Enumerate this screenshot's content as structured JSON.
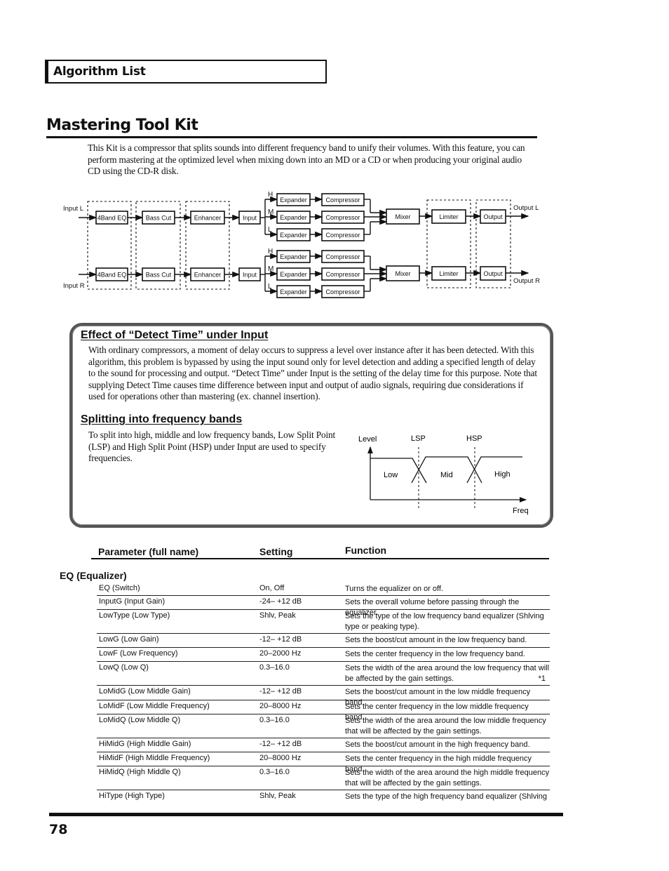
{
  "header": {
    "section_label": "Algorithm List"
  },
  "page_title": "Mastering Tool Kit",
  "intro": "This Kit is a compressor that splits sounds into different frequency band to unify their volumes. With this feature, you can perform mastering at the optimized level when mixing down into an MD or a CD or when producing your original audio CD using the CD-R disk.",
  "diagram": {
    "input_l": "Input L",
    "input_r": "Input R",
    "output_l": "Output L",
    "output_r": "Output R",
    "eq": "4Band EQ",
    "bass_cut": "Bass Cut",
    "enhancer": "Enhancer",
    "input": "Input",
    "band_h": "H",
    "band_m": "M",
    "band_l": "L",
    "expander": "Expander",
    "compressor": "Compressor",
    "mixer": "Mixer",
    "limiter": "Limiter",
    "output": "Output"
  },
  "note": {
    "heading1": "Effect of “Detect Time” under Input",
    "para1": "With ordinary compressors, a moment of delay occurs to suppress a level over instance after it has been detected. With this algorithm, this problem is bypassed by using the input sound only for level detection and adding a specified length of delay to the sound for processing and output. “Detect Time” under Input is the setting of the delay time for this purpose. Note that supplying Detect Time causes time difference between input and output of audio signals, requiring due considerations if used for operations other than mastering (ex. channel insertion).",
    "heading2": "Splitting into frequency bands",
    "para2": "To split into high, middle and low frequency bands, Low Split Point (LSP) and High Split Point (HSP) under Input are used to specify frequencies.",
    "graph": {
      "ylabel": "Level",
      "xlabel": "Freq",
      "lsp": "LSP",
      "hsp": "HSP",
      "bands": [
        "Low",
        "Mid",
        "High"
      ]
    }
  },
  "table": {
    "headers": [
      "Parameter (full name)",
      "Setting",
      "Function"
    ],
    "section": "EQ (Equalizer)",
    "rows": [
      {
        "param": "EQ (Switch)",
        "setting": "On, Off",
        "function": "Turns the equalizer on or off.",
        "note": ""
      },
      {
        "param": "InputG (Input Gain)",
        "setting": "-24– +12 dB",
        "function": "Sets the overall volume before passing through the equalizer.",
        "note": ""
      },
      {
        "param": "LowType (Low Type)",
        "setting": "Shlv, Peak",
        "function": "Sets the type of the low frequency band equalizer (Shlving type or peaking type).",
        "note": ""
      },
      {
        "param": "LowG (Low Gain)",
        "setting": "-12– +12 dB",
        "function": "Sets the boost/cut amount in the low frequency band.",
        "note": ""
      },
      {
        "param": "LowF (Low Frequency)",
        "setting": "20–2000 Hz",
        "function": "Sets the center frequency in the low frequency band.",
        "note": ""
      },
      {
        "param": "LowQ (Low Q)",
        "setting": "0.3–16.0",
        "function": "Sets the width of the area around the low frequency that will be affected by the gain settings.",
        "note": "*1"
      },
      {
        "param": "LoMidG (Low Middle Gain)",
        "setting": "-12– +12 dB",
        "function": "Sets the boost/cut amount in the low middle frequency band.",
        "note": ""
      },
      {
        "param": "LoMidF (Low Middle Frequency)",
        "setting": "20–8000 Hz",
        "function": "Sets the center frequency in the low middle frequency band.",
        "note": ""
      },
      {
        "param": "LoMidQ (Low Middle Q)",
        "setting": "0.3–16.0",
        "function": "Sets the width of the area around the low middle frequency that will be affected by the gain settings.",
        "note": ""
      },
      {
        "param": "HiMidG (High Middle Gain)",
        "setting": "-12– +12 dB",
        "function": "Sets the boost/cut amount in the high frequency band.",
        "note": ""
      },
      {
        "param": "HiMidF (High Middle Frequency)",
        "setting": "20–8000 Hz",
        "function": "Sets the center frequency in the high middle frequency band.",
        "note": ""
      },
      {
        "param": "HiMidQ (High Middle Q)",
        "setting": "0.3–16.0",
        "function": "Sets the width of the area around the high middle frequency that will be affected by the gain settings.",
        "note": ""
      },
      {
        "param": "HiType (High Type)",
        "setting": "Shlv, Peak",
        "function": "Sets the type of the high frequency band equalizer (Shlving",
        "note": ""
      }
    ]
  },
  "footer": {
    "page_number": "78"
  }
}
